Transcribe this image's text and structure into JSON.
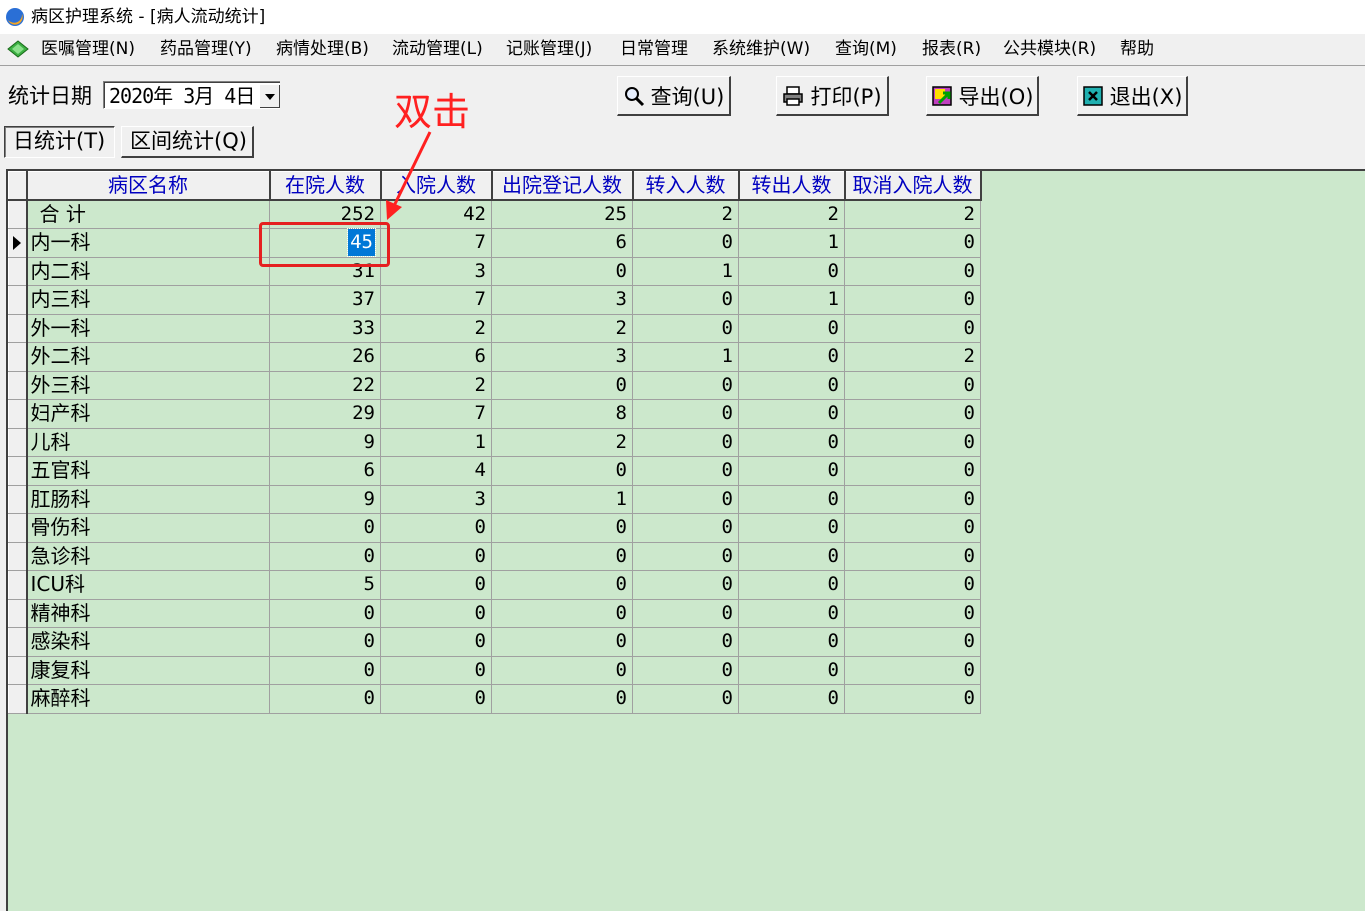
{
  "window": {
    "title": "病区护理系统 - [病人流动统计]"
  },
  "menu": {
    "items": [
      {
        "label": "医嘱管理(N)"
      },
      {
        "label": "药品管理(Y)"
      },
      {
        "label": "病情处理(B)"
      },
      {
        "label": "流动管理(L)"
      },
      {
        "label": "记账管理(J)"
      },
      {
        "label": "日常管理"
      },
      {
        "label": "系统维护(W)"
      },
      {
        "label": "查询(M)"
      },
      {
        "label": "报表(R)"
      },
      {
        "label": "公共模块(R)"
      },
      {
        "label": "帮助"
      }
    ]
  },
  "toolbar": {
    "date_label": "统计日期",
    "date_value": "2020年  3月  4日",
    "buttons": [
      {
        "label": "查询(U)",
        "icon": "search-icon"
      },
      {
        "label": "打印(P)",
        "icon": "printer-icon"
      },
      {
        "label": "导出(O)",
        "icon": "export-icon"
      },
      {
        "label": "退出(X)",
        "icon": "exit-icon"
      }
    ]
  },
  "tabs": [
    {
      "label": "日统计(T)",
      "active": true
    },
    {
      "label": "区间统计(Q)",
      "active": false
    }
  ],
  "table": {
    "headers": [
      "病区名称",
      "在院人数",
      "入院人数",
      "出院登记人数",
      "转入人数",
      "转出人数",
      "取消入院人数"
    ],
    "rows": [
      [
        "合 计",
        "252",
        "42",
        "25",
        "2",
        "2",
        "2"
      ],
      [
        "内一科",
        "45",
        "7",
        "6",
        "0",
        "1",
        "0"
      ],
      [
        "内二科",
        "31",
        "3",
        "0",
        "1",
        "0",
        "0"
      ],
      [
        "内三科",
        "37",
        "7",
        "3",
        "0",
        "1",
        "0"
      ],
      [
        "外一科",
        "33",
        "2",
        "2",
        "0",
        "0",
        "0"
      ],
      [
        "外二科",
        "26",
        "6",
        "3",
        "1",
        "0",
        "2"
      ],
      [
        "外三科",
        "22",
        "2",
        "0",
        "0",
        "0",
        "0"
      ],
      [
        "妇产科",
        "29",
        "7",
        "8",
        "0",
        "0",
        "0"
      ],
      [
        "儿科",
        "9",
        "1",
        "2",
        "0",
        "0",
        "0"
      ],
      [
        "五官科",
        "6",
        "4",
        "0",
        "0",
        "0",
        "0"
      ],
      [
        "肛肠科",
        "9",
        "3",
        "1",
        "0",
        "0",
        "0"
      ],
      [
        "骨伤科",
        "0",
        "0",
        "0",
        "0",
        "0",
        "0"
      ],
      [
        "急诊科",
        "0",
        "0",
        "0",
        "0",
        "0",
        "0"
      ],
      [
        "ICU科",
        "5",
        "0",
        "0",
        "0",
        "0",
        "0"
      ],
      [
        "精神科",
        "0",
        "0",
        "0",
        "0",
        "0",
        "0"
      ],
      [
        "感染科",
        "0",
        "0",
        "0",
        "0",
        "0",
        "0"
      ],
      [
        "康复科",
        "0",
        "0",
        "0",
        "0",
        "0",
        "0"
      ],
      [
        "麻醉科",
        "0",
        "0",
        "0",
        "0",
        "0",
        "0"
      ]
    ],
    "current_row": 1,
    "selected_cell": {
      "row": 1,
      "col": 1
    }
  },
  "annotation": {
    "text": "双击",
    "color": "#ff2020"
  },
  "colors": {
    "grid_bg": "#cce8cc",
    "header_text": "#0000c0",
    "selection": "#0078d7",
    "face": "#f0f0f0"
  }
}
